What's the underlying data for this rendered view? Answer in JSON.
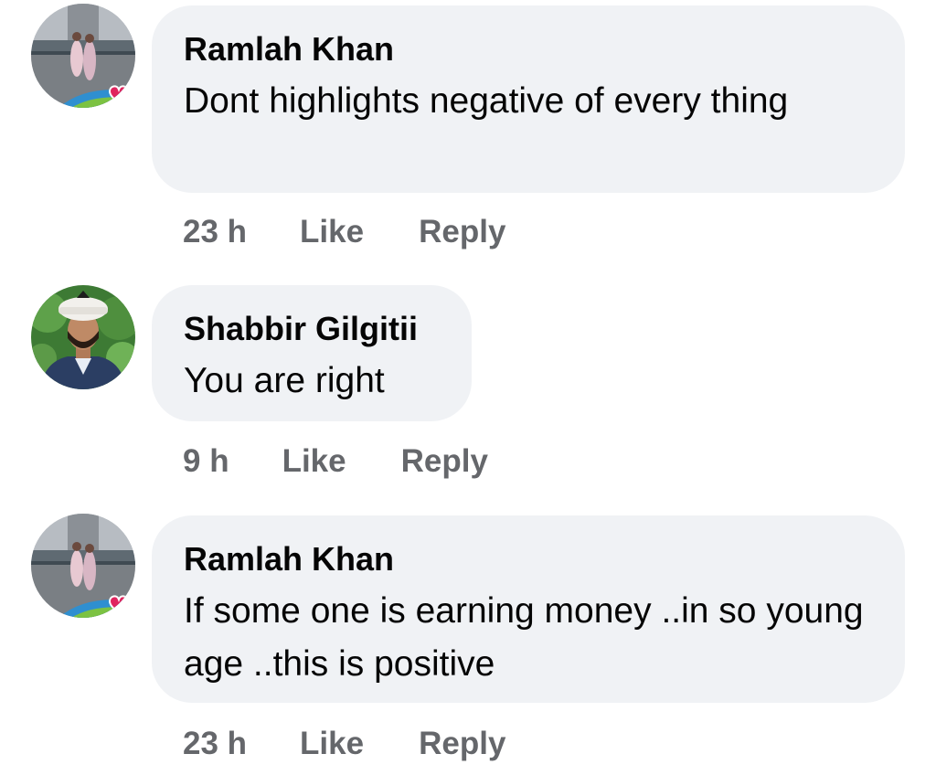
{
  "comments": [
    {
      "author": "Ramlah Khan",
      "text": "Dont highlights negative of every thing",
      "time": "23 h",
      "like_label": "Like",
      "reply_label": "Reply"
    },
    {
      "author": "Shabbir Gilgitii",
      "text": "You are right",
      "time": "9 h",
      "like_label": "Like",
      "reply_label": "Reply"
    },
    {
      "author": "Ramlah Khan",
      "text": "If some one is earning money ..in so young age ..this is positive",
      "time": "23 h",
      "like_label": "Like",
      "reply_label": "Reply"
    }
  ],
  "colors": {
    "bubble": "#f0f2f5",
    "author_text": "#050505",
    "meta_text": "#65676b",
    "heart_badge": "#e0245e"
  }
}
